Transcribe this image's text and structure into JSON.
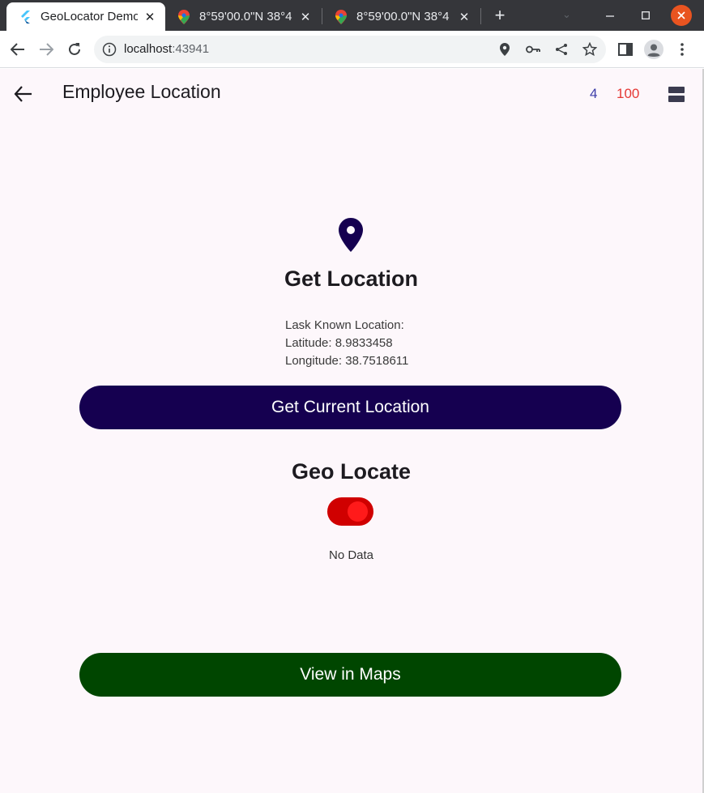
{
  "browser": {
    "tabs": [
      {
        "title": "GeoLocator Demo",
        "favicon": "flutter-icon",
        "active": true
      },
      {
        "title": "8°59'00.0\"N 38°4",
        "favicon": "google-maps-pin-icon",
        "active": false
      },
      {
        "title": "8°59'00.0\"N 38°4",
        "favicon": "google-maps-pin-icon",
        "active": false
      }
    ],
    "address": {
      "host": "localhost",
      "port": ":43941"
    }
  },
  "app": {
    "title": "Employee Location",
    "count_primary": "4",
    "count_secondary": "100",
    "get_location_title": "Get Location",
    "last_known": {
      "heading": "Lask Known Location:",
      "latitude": "Latitude: 8.9833458",
      "longitude": "Longitude: 38.7518611"
    },
    "get_current_label": "Get Current Location",
    "geo_locate_title": "Geo Locate",
    "geo_locate_on": true,
    "status_text": "No Data",
    "view_maps_label": "View in Maps"
  },
  "colors": {
    "primary_button": "#150050",
    "maps_button": "#004600",
    "switch_track": "#d00000",
    "count_primary": "#3c3ca8",
    "count_secondary": "#e53935"
  }
}
